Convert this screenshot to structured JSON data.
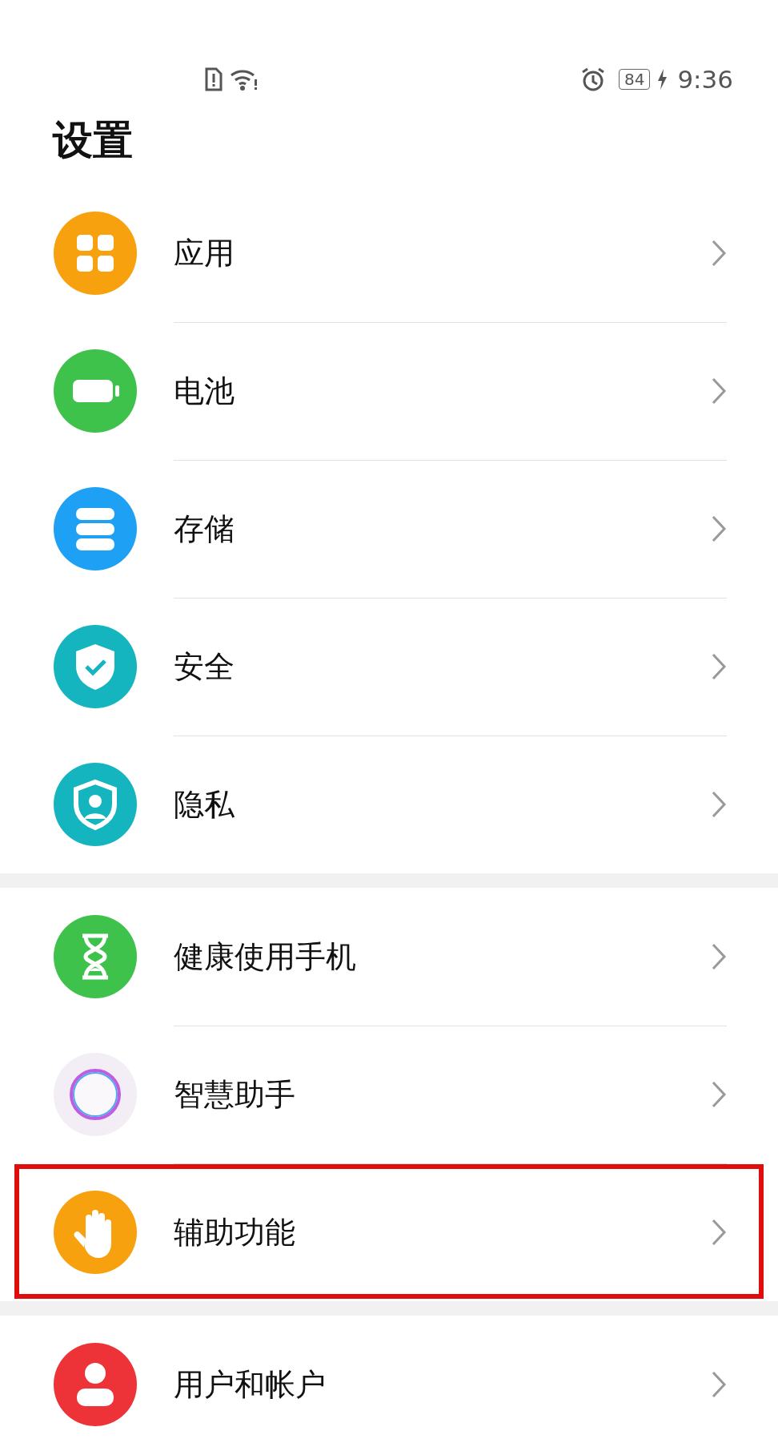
{
  "status_bar": {
    "battery": "84",
    "charging": true,
    "time": "9:36"
  },
  "title": "设置",
  "groups": [
    {
      "items": [
        {
          "label": "应用",
          "kind": "apps",
          "color": "#f7a10f",
          "highlighted": false
        },
        {
          "label": "电池",
          "kind": "battery",
          "color": "#3fc24c",
          "highlighted": false
        },
        {
          "label": "存储",
          "kind": "storage",
          "color": "#1ea1f5",
          "highlighted": false
        },
        {
          "label": "安全",
          "kind": "shield",
          "color": "#14b5be",
          "highlighted": false
        },
        {
          "label": "隐私",
          "kind": "privacy",
          "color": "#14b5be",
          "highlighted": false
        }
      ]
    },
    {
      "items": [
        {
          "label": "健康使用手机",
          "kind": "hourglass",
          "color": "#3fc24c",
          "highlighted": false
        },
        {
          "label": "智慧助手",
          "kind": "ring",
          "color": "#f3eef6",
          "highlighted": false
        },
        {
          "label": "辅助功能",
          "kind": "hand",
          "color": "#f7a10f",
          "highlighted": true
        }
      ]
    },
    {
      "items": [
        {
          "label": "用户和帐户",
          "kind": "user",
          "color": "#ee3338",
          "highlighted": false
        }
      ]
    }
  ]
}
